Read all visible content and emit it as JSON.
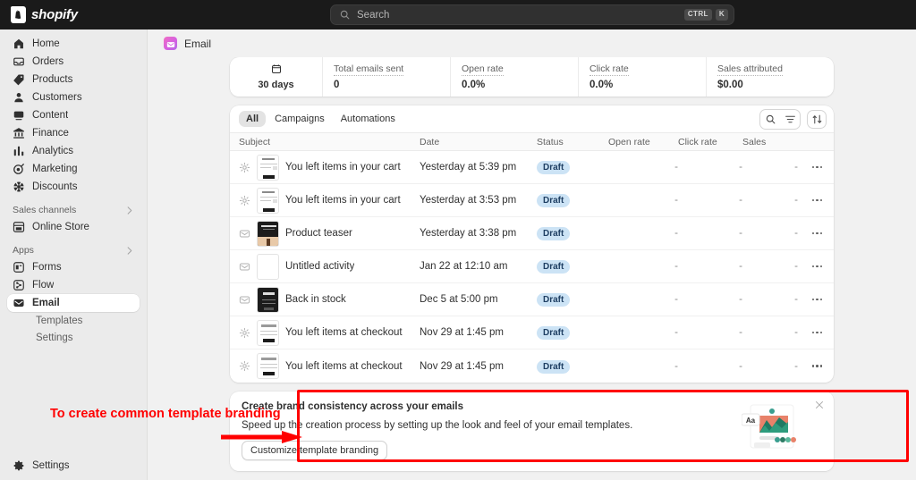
{
  "topbar": {
    "brand_name": "shopify",
    "brand_mark": "S",
    "search": {
      "placeholder": "Search",
      "icon": "search-icon",
      "key_ctrl": "CTRL",
      "key_k": "K"
    }
  },
  "sidebar": {
    "items": [
      {
        "label": "Home",
        "icon": "home-icon"
      },
      {
        "label": "Orders",
        "icon": "orders-icon"
      },
      {
        "label": "Products",
        "icon": "products-tag-icon"
      },
      {
        "label": "Customers",
        "icon": "customers-person-icon"
      },
      {
        "label": "Content",
        "icon": "content-icon"
      },
      {
        "label": "Finance",
        "icon": "finance-bank-icon"
      },
      {
        "label": "Analytics",
        "icon": "analytics-bars-icon"
      },
      {
        "label": "Marketing",
        "icon": "marketing-target-icon"
      },
      {
        "label": "Discounts",
        "icon": "discounts-icon"
      }
    ],
    "sections": [
      {
        "label": "Sales channels",
        "chevron": "chevron-right-icon",
        "items": [
          {
            "label": "Online Store",
            "icon": "online-store-icon"
          }
        ]
      },
      {
        "label": "Apps",
        "chevron": "chevron-right-icon",
        "items": [
          {
            "label": "Forms",
            "icon": "forms-icon"
          },
          {
            "label": "Flow",
            "icon": "flow-icon"
          },
          {
            "label": "Email",
            "icon": "email-envelope-icon",
            "active": true
          }
        ]
      }
    ],
    "sub_items": [
      {
        "label": "Templates"
      },
      {
        "label": "Settings"
      }
    ],
    "bottom": {
      "label": "Settings",
      "icon": "gear-icon"
    }
  },
  "page": {
    "title": "Email",
    "app_icon": "email-app-icon"
  },
  "stats": {
    "period": {
      "label": "30 days",
      "icon": "calendar-icon"
    },
    "cells": [
      {
        "label": "Total emails sent",
        "value": "0"
      },
      {
        "label": "Open rate",
        "value": "0.0%"
      },
      {
        "label": "Click rate",
        "value": "0.0%"
      },
      {
        "label": "Sales attributed",
        "value": "$0.00"
      }
    ]
  },
  "table": {
    "tabs": [
      {
        "label": "All",
        "active": true
      },
      {
        "label": "Campaigns",
        "active": false
      },
      {
        "label": "Automations",
        "active": false
      }
    ],
    "actions": [
      {
        "name": "search-icon"
      },
      {
        "name": "filter-icon"
      },
      {
        "name": "sort-icon"
      }
    ],
    "columns": [
      "Subject",
      "Date",
      "Status",
      "Open rate",
      "Click rate",
      "Sales"
    ],
    "rows": [
      {
        "type_icon": "gear-icon",
        "thumb": "light",
        "subject": "You left items in your cart",
        "date": "Yesterday at 5:39 pm",
        "status": "Draft",
        "open_rate": "-",
        "click_rate": "-",
        "sales": "-",
        "menu": "more-actions-icon"
      },
      {
        "type_icon": "gear-icon",
        "thumb": "light",
        "subject": "You left items in your cart",
        "date": "Yesterday at 3:53 pm",
        "status": "Draft",
        "open_rate": "-",
        "click_rate": "-",
        "sales": "-",
        "menu": "more-actions-icon"
      },
      {
        "type_icon": "envelope-icon",
        "thumb": "dark",
        "subject": "Product teaser",
        "date": "Yesterday at 3:38 pm",
        "status": "Draft",
        "open_rate": "-",
        "click_rate": "-",
        "sales": "-",
        "menu": "more-actions-icon"
      },
      {
        "type_icon": "envelope-icon",
        "thumb": "blank",
        "subject": "Untitled activity",
        "date": "Jan 22 at 12:10 am",
        "status": "Draft",
        "open_rate": "-",
        "click_rate": "-",
        "sales": "-",
        "menu": "more-actions-icon"
      },
      {
        "type_icon": "envelope-icon",
        "thumb": "dark",
        "subject": "Back in stock",
        "date": "Dec 5 at 5:00 pm",
        "status": "Draft",
        "open_rate": "-",
        "click_rate": "-",
        "sales": "-",
        "menu": "more-actions-icon"
      },
      {
        "type_icon": "gear-icon",
        "thumb": "light",
        "subject": "You left items at checkout",
        "date": "Nov 29 at 1:45 pm",
        "status": "Draft",
        "open_rate": "-",
        "click_rate": "-",
        "sales": "-",
        "menu": "more-actions-icon"
      },
      {
        "type_icon": "gear-icon",
        "thumb": "light",
        "subject": "You left items at checkout",
        "date": "Nov 29 at 1:45 pm",
        "status": "Draft",
        "open_rate": "-",
        "click_rate": "-",
        "sales": "-",
        "menu": "more-actions-icon"
      }
    ]
  },
  "promo": {
    "title": "Create brand consistency across your emails",
    "description": "Speed up the creation process by setting up the look and feel of your email templates.",
    "button": "Customize template branding",
    "close_icon": "close-icon",
    "art": {
      "badge": "Aa",
      "icon": "email-template-illustration"
    }
  },
  "annotation": {
    "text": "To create common template branding",
    "color": "#ff0000",
    "arrow": "right-arrow"
  }
}
